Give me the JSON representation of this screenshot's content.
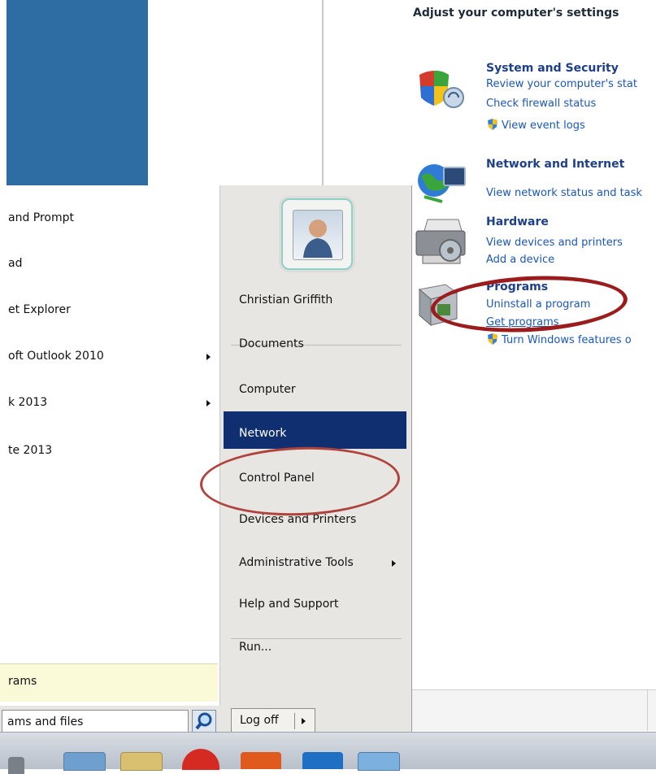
{
  "control_panel": {
    "heading": "Adjust your computer's settings",
    "categories": [
      {
        "title": "System and Security",
        "links": [
          "Review your computer's stat",
          "Check firewall status",
          "View event logs"
        ]
      },
      {
        "title": "Network and Internet",
        "links": [
          "View network status and task"
        ]
      },
      {
        "title": "Hardware",
        "links": [
          "View devices and printers",
          "Add a device"
        ]
      },
      {
        "title": "Programs",
        "links": [
          "Uninstall a program",
          "Get programs",
          "Turn Windows features o"
        ]
      }
    ]
  },
  "start_menu": {
    "programs": [
      {
        "label": "and Prompt",
        "submenu": false
      },
      {
        "label": "ad",
        "submenu": false
      },
      {
        "label": "et Explorer",
        "submenu": false
      },
      {
        "label": "oft Outlook 2010",
        "submenu": true
      },
      {
        "label": "k 2013",
        "submenu": true
      },
      {
        "label": "te 2013",
        "submenu": false
      }
    ],
    "all_programs": "rams",
    "search_text": "ams and files",
    "right_items": [
      "Christian Griffith",
      "Documents",
      "Computer",
      "Network",
      "Control Panel",
      "Devices and Printers",
      "Administrative Tools",
      "Help and Support",
      "Run..."
    ],
    "highlighted_item": "Network",
    "logoff_label": "Log off"
  },
  "colors": {
    "highlight_blue": "#0f2f70",
    "annotation_red": "#9b1c1c",
    "link_blue": "#1a57b8",
    "title_blue": "#1e3f8a",
    "desktop_blue": "#2e6da4"
  },
  "icons": [
    "shield-security-icon",
    "network-globe-icon",
    "printer-hardware-icon",
    "programs-box-icon",
    "uac-shield-icon",
    "user-avatar-icon",
    "search-icon",
    "chevron-right-icon"
  ]
}
